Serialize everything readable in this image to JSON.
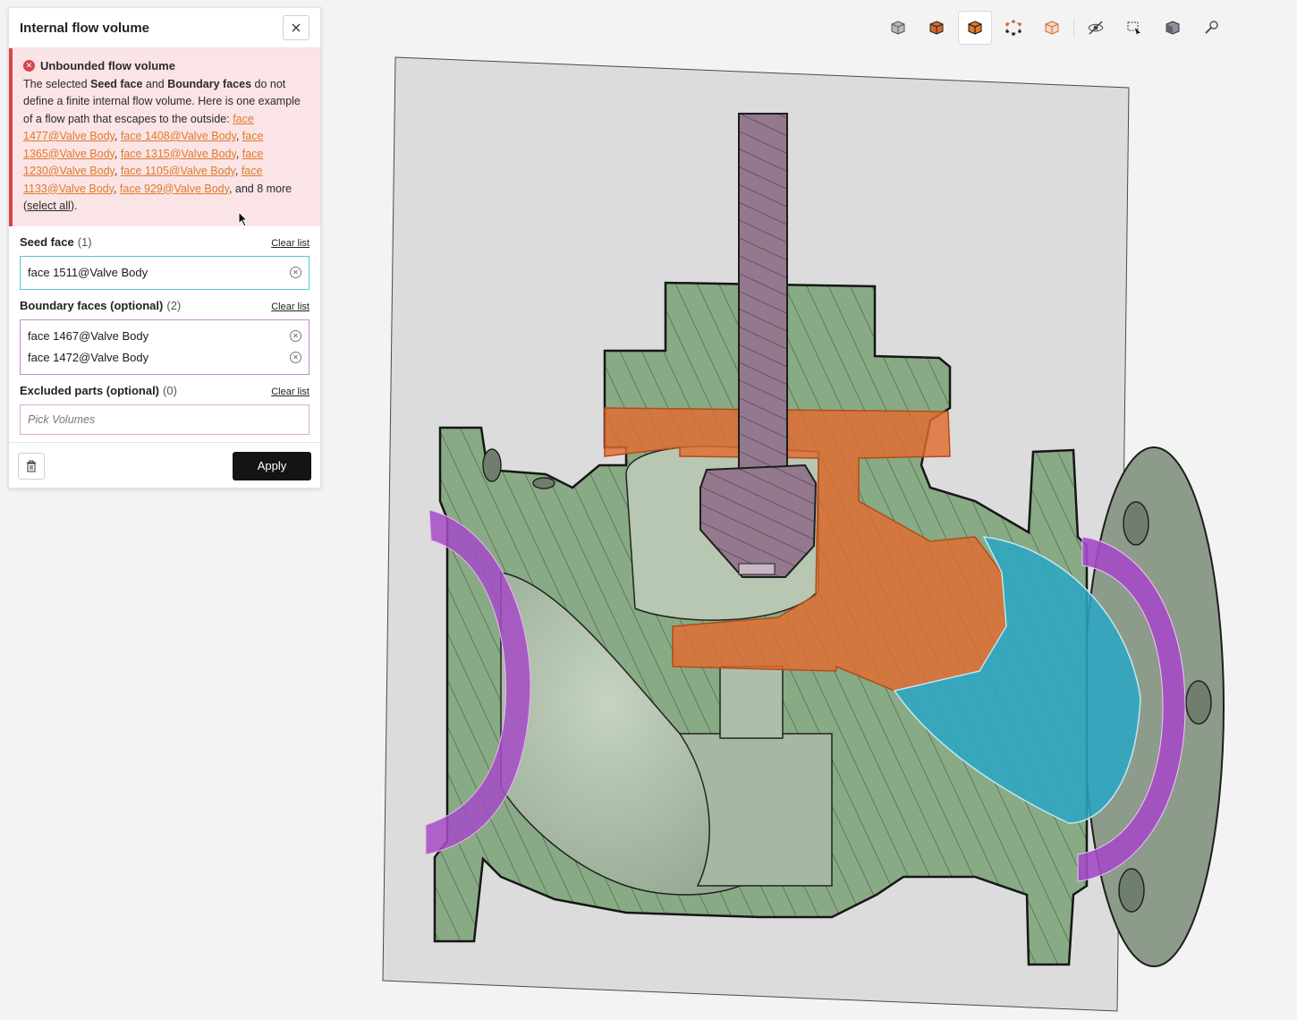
{
  "panel": {
    "title": "Internal flow volume",
    "alert": {
      "title": "Unbounded flow volume",
      "msg_prefix": "The selected ",
      "seed_strong": "Seed face",
      "msg_and": " and ",
      "boundary_strong": "Boundary faces",
      "msg_rest": " do not define a finite internal flow volume. Here is one example of a flow path that escapes to the outside: ",
      "faces": [
        "face 1477@Valve Body",
        "face 1408@Valve Body",
        "face 1365@Valve Body",
        "face 1315@Valve Body",
        "face 1230@Valve Body",
        "face 1105@Valve Body",
        "face 1133@Valve Body",
        "face 929@Valve Body"
      ],
      "more_text": ", and 8 more (",
      "select_all": "select all",
      "end_text": ")."
    },
    "seed": {
      "label": "Seed face",
      "count": "(1)",
      "clear": "Clear list",
      "items": [
        "face 1511@Valve Body"
      ]
    },
    "boundary": {
      "label": "Boundary faces (optional)",
      "count": "(2)",
      "clear": "Clear list",
      "items": [
        "face 1467@Valve Body",
        "face 1472@Valve Body"
      ]
    },
    "excluded": {
      "label": "Excluded parts (optional)",
      "count": "(0)",
      "clear": "Clear list",
      "placeholder": "Pick Volumes"
    },
    "apply": "Apply"
  },
  "toolbar": {
    "buttons": [
      "view-cube-icon",
      "solid-box-icon",
      "highlighted-box-icon",
      "vertex-select-icon",
      "outline-box-icon",
      "hide-icon",
      "box-select-icon",
      "shaded-body-icon",
      "wrench-icon"
    ],
    "active_index": 2
  },
  "colors": {
    "seed": "#56c6d8",
    "boundary": "#a44bc5",
    "flow_path": "#e26b2f",
    "body": "#9db39b",
    "error": "#d9434f",
    "apply": "#141414"
  }
}
